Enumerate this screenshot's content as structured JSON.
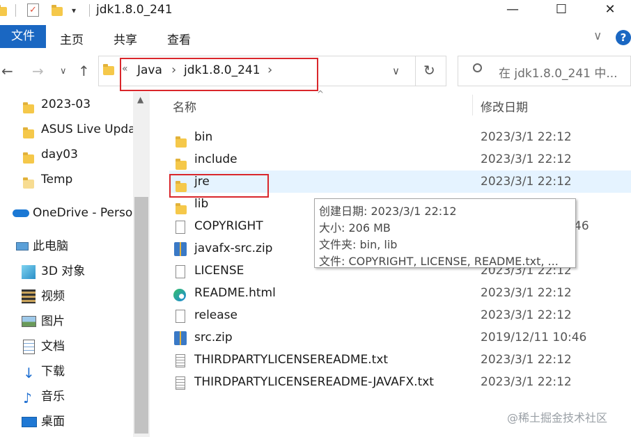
{
  "window": {
    "title": "jdk1.8.0_241",
    "minimize_glyph": "—",
    "maximize_glyph": "☐",
    "close_glyph": "✕"
  },
  "ribbon": {
    "tabs": [
      "文件",
      "主页",
      "共享",
      "查看"
    ],
    "expand_glyph": "∨",
    "help_glyph": "?"
  },
  "address": {
    "prefix": "«",
    "crumbs": [
      "Java",
      "jdk1.8.0_241"
    ],
    "separator": "›",
    "refresh_glyph": "↻"
  },
  "search": {
    "placeholder": "在 jdk1.8.0_241 中..."
  },
  "sidebar": {
    "quick_items": [
      "2023-03",
      "ASUS Live Upda",
      "day03",
      "Temp"
    ],
    "onedrive": "OneDrive - Perso",
    "this_pc": "此电脑",
    "pc_items": [
      {
        "label": "3D 对象",
        "icon": "cube-icon"
      },
      {
        "label": "视频",
        "icon": "video-icon"
      },
      {
        "label": "图片",
        "icon": "picture-icon"
      },
      {
        "label": "文档",
        "icon": "document-icon"
      },
      {
        "label": "下载",
        "icon": "download-icon"
      },
      {
        "label": "音乐",
        "icon": "music-icon"
      },
      {
        "label": "桌面",
        "icon": "desktop-icon"
      }
    ]
  },
  "columns": {
    "name": "名称",
    "date": "修改日期"
  },
  "files": [
    {
      "name": "bin",
      "date": "2023/3/1 22:12",
      "icon": "folder-icon"
    },
    {
      "name": "include",
      "date": "2023/3/1 22:12",
      "icon": "folder-icon"
    },
    {
      "name": "jre",
      "date": "2023/3/1 22:12",
      "icon": "folder-icon"
    },
    {
      "name": "lib",
      "date": "",
      "icon": "folder-icon"
    },
    {
      "name": "COPYRIGHT",
      "date": "46",
      "icon": "file-icon"
    },
    {
      "name": "javafx-src.zip",
      "date": "",
      "icon": "zip-icon"
    },
    {
      "name": "LICENSE",
      "date": "2023/3/1 22:12",
      "icon": "file-icon"
    },
    {
      "name": "README.html",
      "date": "2023/3/1 22:12",
      "icon": "edge-icon"
    },
    {
      "name": "release",
      "date": "2023/3/1 22:12",
      "icon": "file-icon"
    },
    {
      "name": "src.zip",
      "date": "2019/12/11 10:46",
      "icon": "zip-icon"
    },
    {
      "name": "THIRDPARTYLICENSEREADME.txt",
      "date": "2023/3/1 22:12",
      "icon": "text-file-icon"
    },
    {
      "name": "THIRDPARTYLICENSEREADME-JAVAFX.txt",
      "date": "2023/3/1 22:12",
      "icon": "text-file-icon"
    }
  ],
  "tooltip": {
    "lines": [
      "创建日期: 2023/3/1 22:12",
      "大小: 206 MB",
      "文件夹: bin, lib",
      "文件: COPYRIGHT, LICENSE, README.txt, ..."
    ]
  },
  "watermark": "@稀土掘金技术社区",
  "colors": {
    "accent": "#1a67c2",
    "highlight": "#d9262b",
    "selection": "#e5f3ff"
  }
}
